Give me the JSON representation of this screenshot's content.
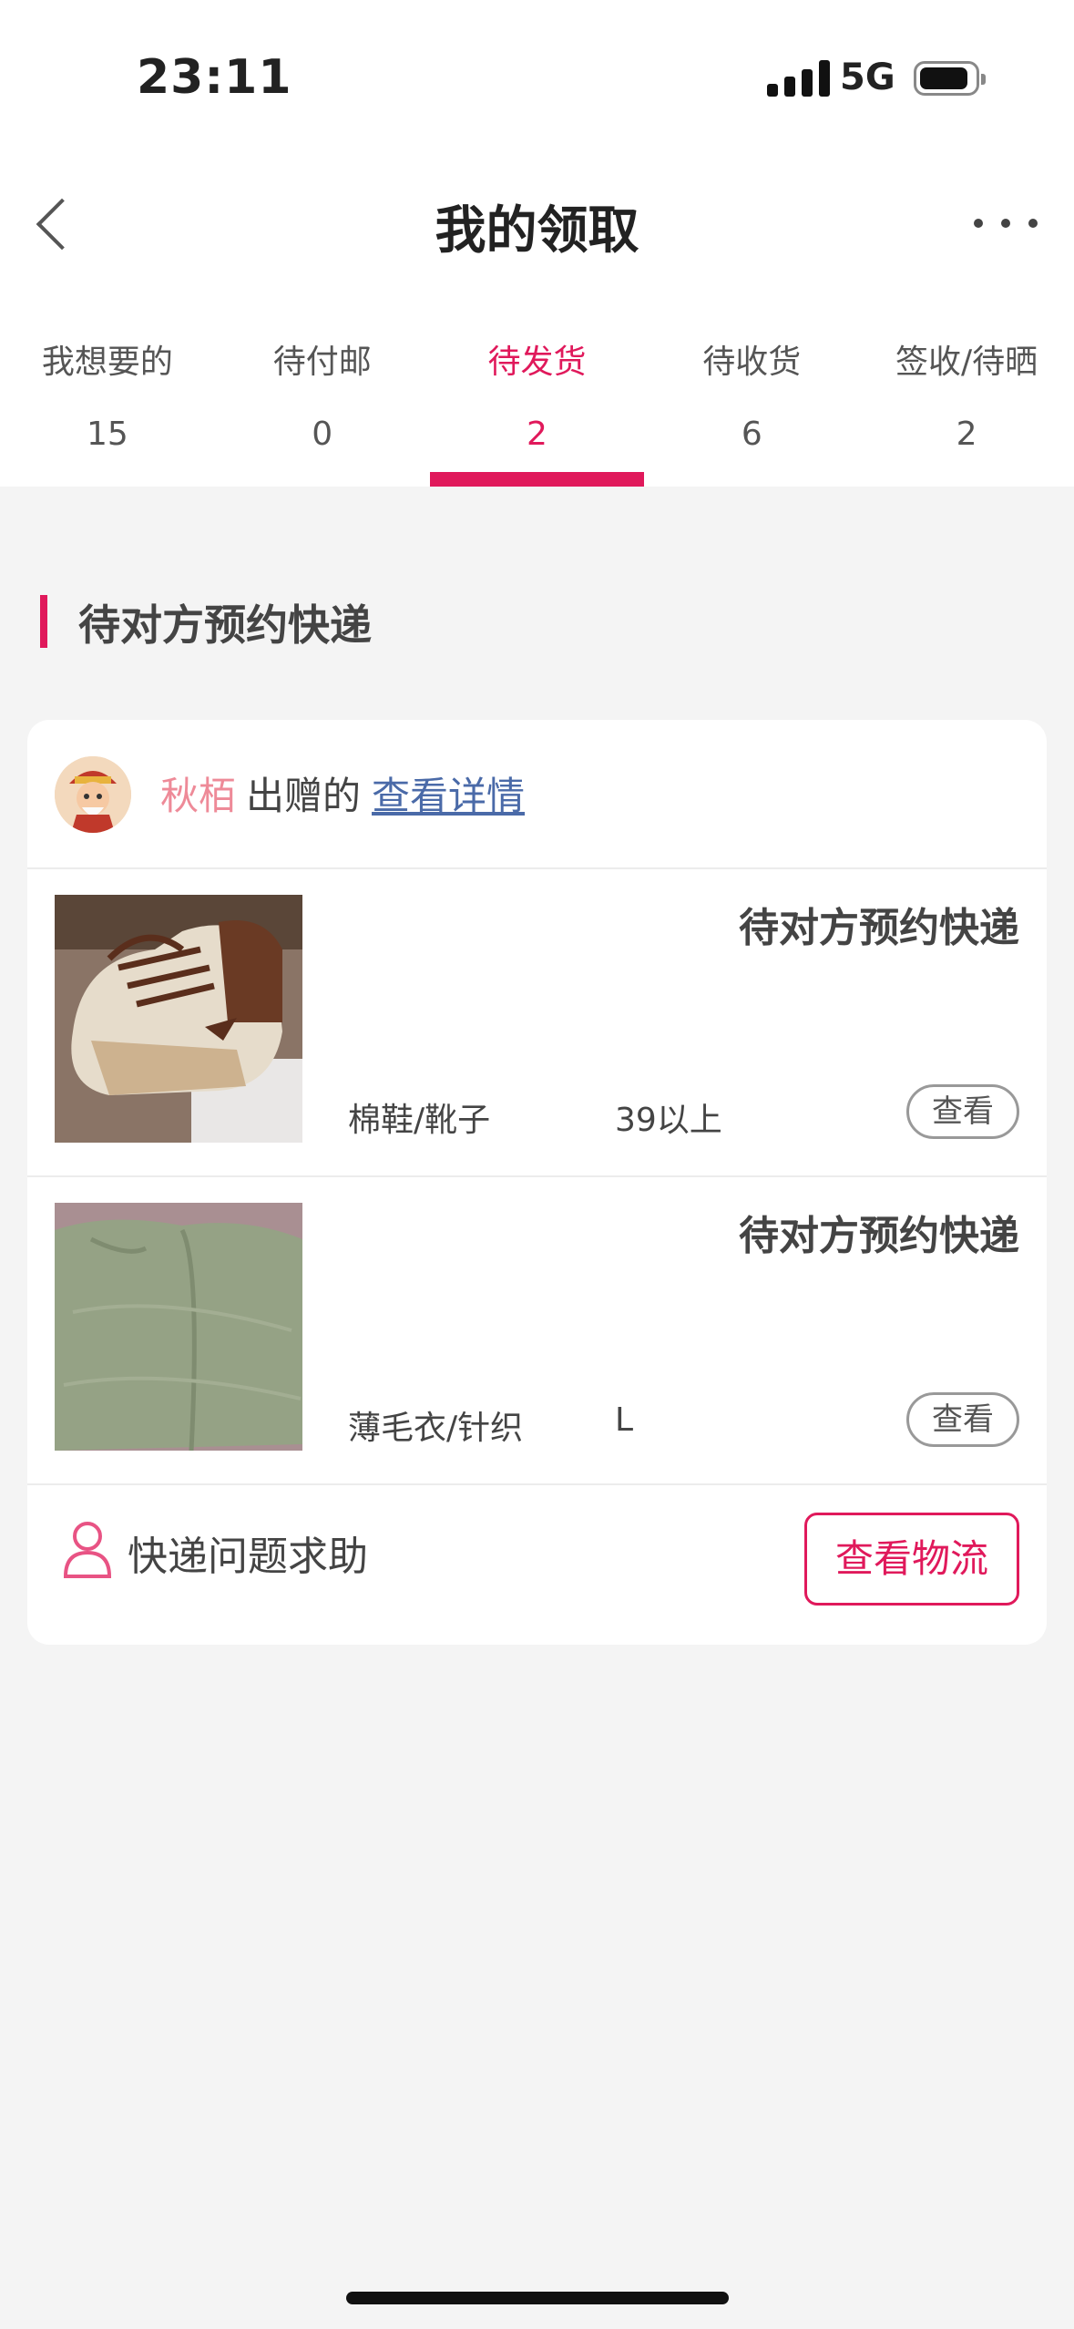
{
  "status_bar": {
    "time": "23:11",
    "network": "5G"
  },
  "header": {
    "title": "我的领取"
  },
  "tabs": [
    {
      "label": "我想要的",
      "count": "15"
    },
    {
      "label": "待付邮",
      "count": "0"
    },
    {
      "label": "待发货",
      "count": "2",
      "active": true
    },
    {
      "label": "待收货",
      "count": "6"
    },
    {
      "label": "签收/待晒",
      "count": "2"
    }
  ],
  "section": {
    "title": "待对方预约快递"
  },
  "order": {
    "giver_name": "秋栢",
    "giver_suffix": "出赠的",
    "detail_link": "查看详情",
    "items": [
      {
        "status": "待对方预约快递",
        "category": "棉鞋/靴子",
        "size": "39以上",
        "view_label": "查看",
        "image": "sneaker-photo"
      },
      {
        "status": "待对方预约快递",
        "category": "薄毛衣/针织",
        "size": "L",
        "view_label": "查看",
        "image": "green-knit-photo"
      }
    ],
    "help_label": "快递问题求助",
    "logistics_button": "查看物流"
  },
  "colors": {
    "accent": "#e0195b",
    "giver_name": "#ee8a98",
    "link": "#4a6aa8",
    "background": "#f4f4f4"
  }
}
